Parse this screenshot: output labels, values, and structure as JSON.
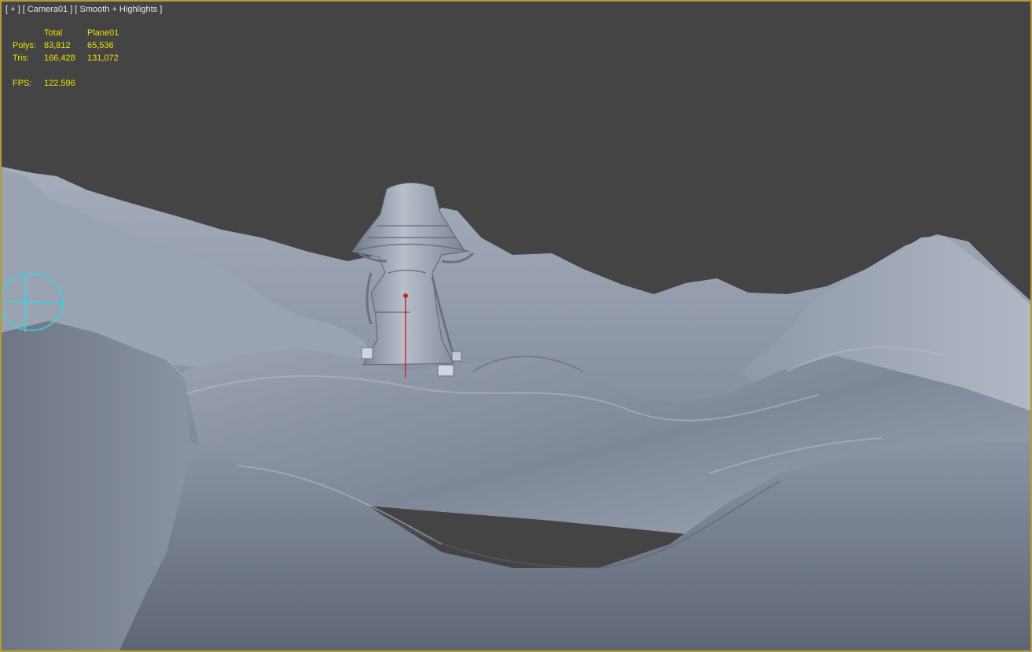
{
  "viewport": {
    "label_plus": "[ + ]",
    "label_camera": "[ Camera01 ]",
    "label_shading": "[ Smooth + Highlights ]",
    "border_color": "#b49a3a",
    "background_color": "#444444"
  },
  "stats": {
    "header_total": "Total",
    "header_object": "Plane01",
    "polys_label": "Polys:",
    "polys_total": "83,812",
    "polys_object": "65,536",
    "tris_label": "Tris:",
    "tris_total": "166,428",
    "tris_object": "131,072",
    "fps_label": "FPS:",
    "fps_value": "122.596",
    "text_color": "#f0e000"
  },
  "scene": {
    "terrain_color": "#8f98a8",
    "camera_gizmo_color": "#33d6e6",
    "tower_icon": "mushroom-tower",
    "camera_icon": "camera-gizmo-icon"
  }
}
